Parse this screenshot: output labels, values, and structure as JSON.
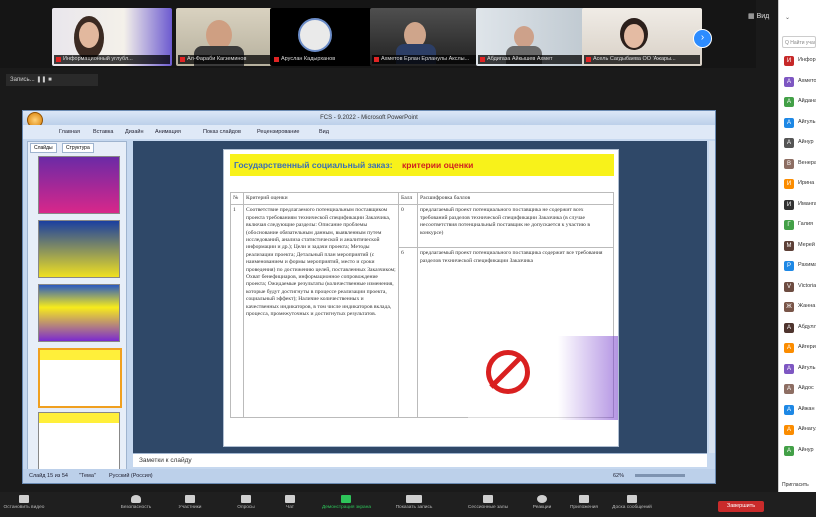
{
  "meeting": {
    "participants_tiles": [
      {
        "name": "Информационный углубл..."
      },
      {
        "name": "Ал-Фараби Кагземинов"
      },
      {
        "name": "Аруслан Кадырханов"
      },
      {
        "name": "Ахметов Ерлан Ерланулы Акслы..."
      },
      {
        "name": "Абдигаза Айкышев Ахмет"
      },
      {
        "name": "Асель Сагдыбаева ОО 'Ажары..."
      }
    ],
    "next_icon": "chevron-right-icon",
    "view_label": "Вид",
    "rec_label": "Запись..."
  },
  "ppt": {
    "window_title": "FCS - 9.2022 - Microsoft PowerPoint",
    "ribbon": [
      "Главная",
      "Вставка",
      "Дизайн",
      "Анимация",
      "Показ слайдов",
      "Рецензирование",
      "Вид"
    ],
    "tabs": [
      "Слайды",
      "Структура"
    ],
    "slide": {
      "title_blue": "Государственный социальный заказ:",
      "title_red": "критерии оценки",
      "headers": [
        "№",
        "Критерий оценки",
        "Балл",
        "Расшифровка баллов"
      ],
      "row_no": "1",
      "criteria_text": "Соответствие предлагаемого потенциальным поставщиком проекта требованиям технической спецификации Заказчика, включая следующие разделы: Описание проблемы (обоснование обязательным данным, выявленным путем исследований, анализа статистической и аналитической информации и др.); Цели и задачи проекта; Методы реализации проекта; Детальный план мероприятий (с наименованием и формы мероприятий, место и сроки проведения) по достижению целей, поставленных Заказчиком; Охват бенефициаров, информационное сопровождение проекта; Ожидаемые результаты (количественные изменения, которые будут достигнуты в процессе реализации проекта, социальный эффект); Наличие количественных и качественных индикаторов, в том числе индикаторов вклада, процесса, промежуточных и достигнутых результатов.",
      "score_a": "0",
      "score_a_text": "предлагаемый проект потенциального поставщика не содержит всех требований разделов технической спецификации Заказчика (в случае несоответствия потенциальный поставщик не допускается к участию в конкурсе)",
      "score_b": "6",
      "score_b_text": "предлагаемый проект потенциального поставщика содержит все требования разделов технической спецификации Заказчика"
    },
    "notes_placeholder": "Заметки к слайду",
    "status": {
      "slide": "Слайд 15 из 54",
      "theme": "\"Тема\"",
      "lang": "Русский (Россия)",
      "zoom": "62%"
    }
  },
  "participants": {
    "search_placeholder": "Q Найти участника",
    "list": [
      {
        "name": "Информ",
        "color": "#c62828"
      },
      {
        "name": "Ахметов",
        "color": "#7e57c2"
      },
      {
        "name": "Айдана",
        "color": "#43a047"
      },
      {
        "name": "Айгуль",
        "color": "#1e88e5"
      },
      {
        "name": "Айнур",
        "color": "#555555"
      },
      {
        "name": "Венера",
        "color": "#8d6e63"
      },
      {
        "name": "Ирина",
        "color": "#fb8c00"
      },
      {
        "name": "Имангали",
        "color": "#333333"
      },
      {
        "name": "Галия",
        "color": "#43a047"
      },
      {
        "name": "Мерей",
        "color": "#5d4037"
      },
      {
        "name": "Рахима",
        "color": "#1e88e5"
      },
      {
        "name": "Victoria",
        "color": "#6d4c41"
      },
      {
        "name": "Жанна",
        "color": "#795548"
      },
      {
        "name": "Абдуллаев",
        "color": "#4e342e"
      },
      {
        "name": "Айгерим",
        "color": "#fb8c00"
      },
      {
        "name": "Айгуль",
        "color": "#7e57c2"
      },
      {
        "name": "Айдос",
        "color": "#8d6e63"
      },
      {
        "name": "Айжан",
        "color": "#1e88e5"
      },
      {
        "name": "Айнагуль",
        "color": "#fb8c00"
      },
      {
        "name": "Айнур",
        "color": "#43a047"
      }
    ],
    "invite": "Пригласить"
  },
  "toolbar": {
    "items": [
      "Остановить видео",
      "Безопасность",
      "Участники",
      "Опросы",
      "Чат",
      "Демонстрация экрана",
      "Показать запись",
      "Сессионные залы",
      "Реакции",
      "Приложения",
      "Доска сообщений"
    ],
    "end": "Завершить"
  }
}
